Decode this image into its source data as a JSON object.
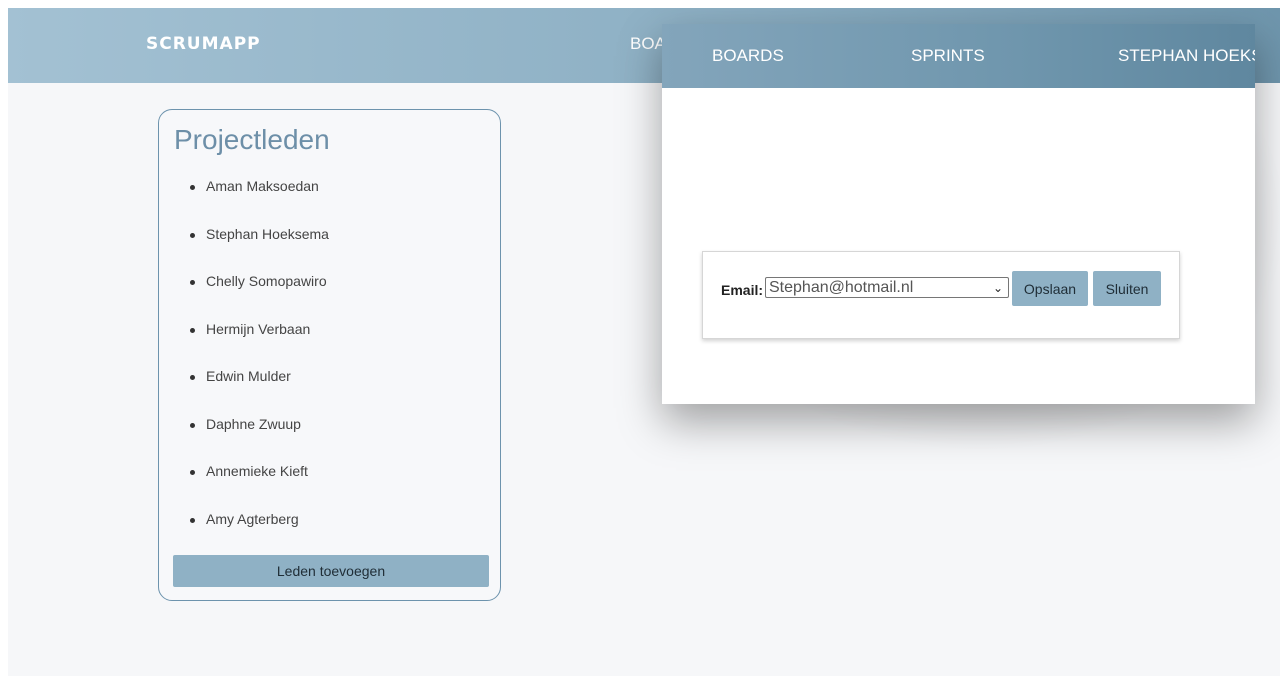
{
  "app": {
    "brand": "SCRUMAPP",
    "background_nav_partial": "BOA"
  },
  "members": {
    "title": "Projectleden",
    "items": [
      "Aman Maksoedan",
      "Stephan Hoeksema",
      "Chelly Somopawiro",
      "Hermijn Verbaan",
      "Edwin Mulder",
      "Daphne Zwuup",
      "Annemieke Kieft",
      "Amy Agterberg"
    ],
    "add_button": "Leden toevoegen"
  },
  "modal": {
    "nav": {
      "boards": "BOARDS",
      "sprints": "SPRINTS",
      "user": "STEPHAN HOEKS"
    },
    "form": {
      "email_label": "Email:",
      "email_selected": "Stephan@hotmail.nl",
      "save_button": "Opslaan",
      "close_button": "Sluiten"
    }
  },
  "colors": {
    "accent": "#8fb1c5",
    "header_dark": "#6f96ad",
    "title_text": "#6d8fa8"
  }
}
